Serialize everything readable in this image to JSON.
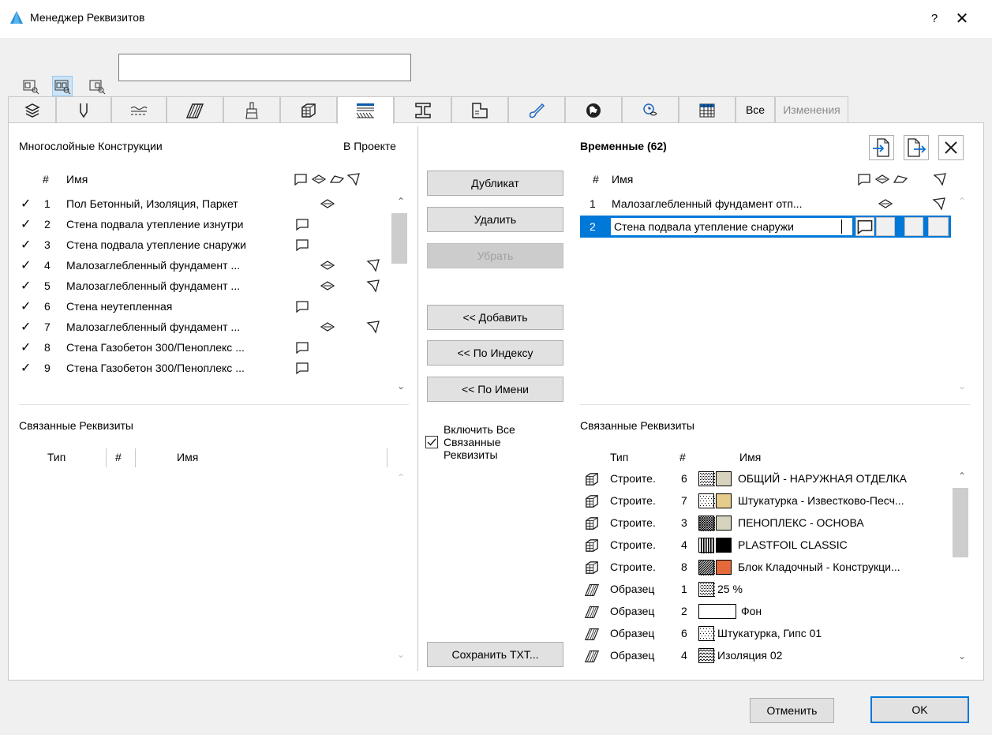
{
  "window": {
    "title": "Менеджер Реквизитов",
    "help": "?",
    "close": "✕"
  },
  "tabs": {
    "all_label": "Все",
    "changes_label": "Изменения"
  },
  "left": {
    "header": "Многослойные Конструкции",
    "in_project": "В Проекте",
    "col_num": "#",
    "col_name": "Имя",
    "rows": [
      {
        "check": "✓",
        "num": "1",
        "name": "Пол Бетонный, Изоляция, Паркет",
        "icons": [
          "eye"
        ]
      },
      {
        "check": "✓",
        "num": "2",
        "name": "Стена подвала утепление изнутри",
        "icons": [
          "wall"
        ]
      },
      {
        "check": "✓",
        "num": "3",
        "name": "Стена подвала утепление снаружи",
        "icons": [
          "wall"
        ]
      },
      {
        "check": "✓",
        "num": "4",
        "name": "Малозаглебленный фундамент ...",
        "icons": [
          "eye",
          "flag"
        ]
      },
      {
        "check": "✓",
        "num": "5",
        "name": "Малозаглебленный фундамент ...",
        "icons": [
          "eye",
          "flag"
        ]
      },
      {
        "check": "✓",
        "num": "6",
        "name": "Стена неутепленная",
        "icons": [
          "wall"
        ]
      },
      {
        "check": "✓",
        "num": "7",
        "name": "Малозаглебленный фундамент ...",
        "icons": [
          "eye",
          "flag"
        ]
      },
      {
        "check": "✓",
        "num": "8",
        "name": "Стена Газобетон 300/Пеноплекс ...",
        "icons": [
          "wall"
        ]
      },
      {
        "check": "✓",
        "num": "9",
        "name": "Стена Газобетон 300/Пеноплекс ...",
        "icons": [
          "wall"
        ]
      }
    ],
    "linked_header": "Связанные Реквизиты",
    "linked_cols": {
      "type": "Тип",
      "num": "#",
      "name": "Имя"
    }
  },
  "middle": {
    "duplicate": "Дубликат",
    "delete": "Удалить",
    "remove": "Убрать",
    "add": "<< Добавить",
    "by_index": "<< По Индексу",
    "by_name": "<< По Имени",
    "include_all_checked": true,
    "include_all": "Включить Все Связанные Реквизиты",
    "save_txt": "Сохранить ТХТ..."
  },
  "right": {
    "header": "Временные (62)",
    "col_num": "#",
    "col_name": "Имя",
    "rows": [
      {
        "num": "1",
        "name": "Малозаглебленный фундамент отп...",
        "icons": [
          "eye",
          "flag"
        ]
      },
      {
        "num": "2",
        "name": "Стена подвала утепление снаружи",
        "selected": true
      }
    ],
    "linked_header": "Связанные Реквизиты",
    "linked_cols": {
      "type": "Тип",
      "num": "#",
      "name": "Имя"
    },
    "linked_rows": [
      {
        "type": "Строите.",
        "num": "6",
        "name": "ОБЩИЙ - НАРУЖНАЯ ОТДЕЛКА",
        "kind": "building",
        "pattern": "dots-dense",
        "color": "#d8d3bf"
      },
      {
        "type": "Строите.",
        "num": "7",
        "name": "Штукатурка - Известково-Песч...",
        "kind": "building",
        "pattern": "dots",
        "color": "#e6cc8a"
      },
      {
        "type": "Строите.",
        "num": "3",
        "name": "ПЕНОПЛЕКС - ОСНОВА",
        "kind": "building",
        "pattern": "cross",
        "color": "#d6d3bf"
      },
      {
        "type": "Строите.",
        "num": "4",
        "name": "PLASTFOIL CLASSIC",
        "kind": "building",
        "pattern": "vlines",
        "color": "#000000"
      },
      {
        "type": "Строите.",
        "num": "8",
        "name": "Блок Кладочный - Конструкци...",
        "kind": "building",
        "pattern": "diag",
        "color": "#e46a3c"
      },
      {
        "type": "Образец",
        "num": "1",
        "name": "25 %",
        "kind": "hatch",
        "pattern": "dots-dense"
      },
      {
        "type": "Образец",
        "num": "2",
        "name": "Фон",
        "kind": "hatch",
        "pattern": "empty"
      },
      {
        "type": "Образец",
        "num": "6",
        "name": "Штукатурка, Гипс 01",
        "kind": "hatch",
        "pattern": "dots"
      },
      {
        "type": "Образец",
        "num": "4",
        "name": "Изоляция 02",
        "kind": "hatch",
        "pattern": "zigzag"
      }
    ]
  },
  "footer": {
    "cancel": "Отменить",
    "ok": "OK"
  },
  "colors": {
    "accent": "#0078d7",
    "selection": "#0078d7"
  }
}
